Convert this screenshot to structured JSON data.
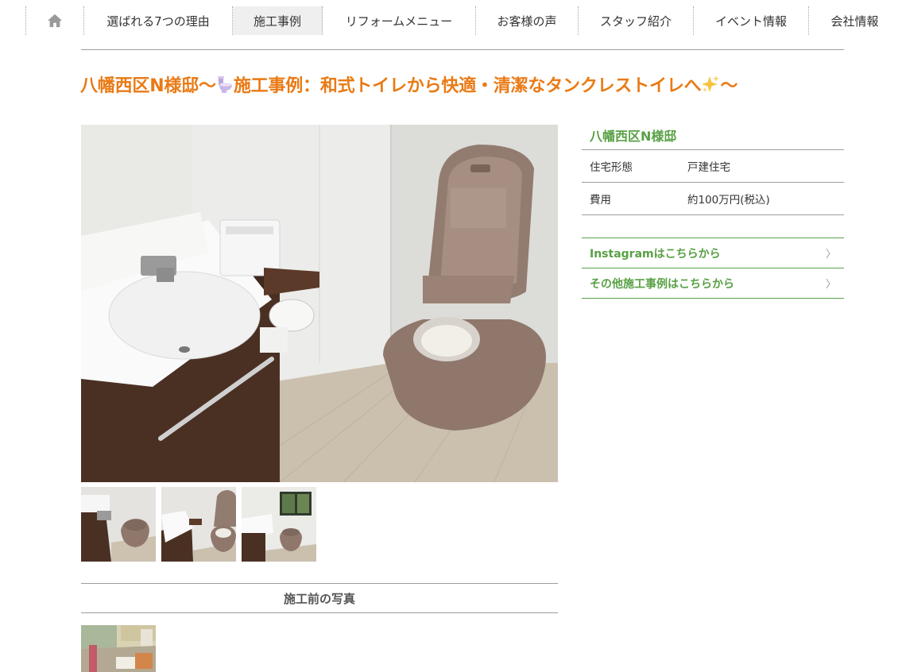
{
  "nav": {
    "items": [
      {
        "label": "選ばれる7つの理由",
        "active": false
      },
      {
        "label": "施工事例",
        "active": true
      },
      {
        "label": "リフォームメニュー",
        "active": false
      },
      {
        "label": "お客様の声",
        "active": false
      },
      {
        "label": "スタッフ紹介",
        "active": false
      },
      {
        "label": "イベント情報",
        "active": false
      },
      {
        "label": "会社情報",
        "active": false
      }
    ],
    "home_icon": "home-icon"
  },
  "page": {
    "title_before": "八幡西区N様邸～",
    "title_emoji_1": "toilet-emoji",
    "title_middle": "施工事例：和式トイレから快適・清潔なタンクレストイレへ",
    "title_emoji_2": "sparkles-emoji",
    "title_after": "～"
  },
  "photos": {
    "main": "tankless-toilet-photo",
    "thumbnails": [
      "toilet-thumbnail-1",
      "toilet-thumbnail-2",
      "toilet-thumbnail-3"
    ],
    "before_heading": "施工前の写真",
    "before_thumbnails": [
      "before-thumbnail-1"
    ]
  },
  "info": {
    "name": "八幡西区N様邸",
    "rows": [
      {
        "key": "住宅形態",
        "value": "戸建住宅"
      },
      {
        "key": "費用",
        "value": "約100万円(税込)"
      }
    ],
    "links": [
      {
        "label": "Instagramはこちらから",
        "chevron": "〉"
      },
      {
        "label": "その他施工事例はこちらから",
        "chevron": "〉"
      }
    ]
  },
  "colors": {
    "title": "#ea7a15",
    "accent_green": "#58a044",
    "nav_active_bg": "#efefef"
  }
}
